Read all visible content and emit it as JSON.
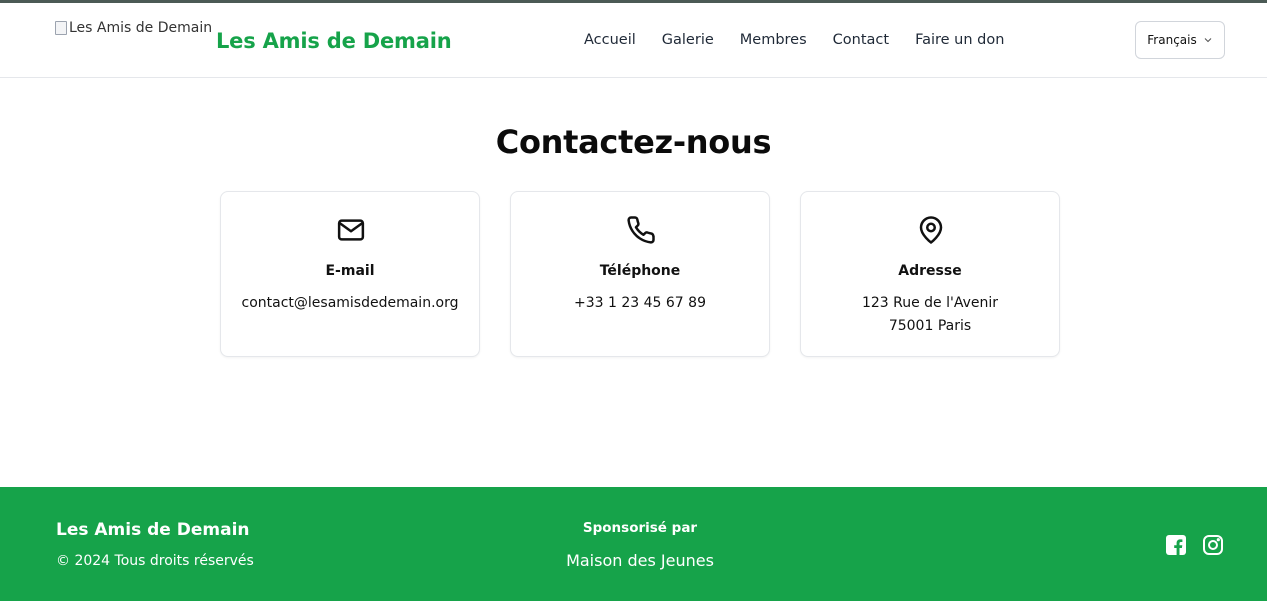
{
  "header": {
    "logo_alt": "Les Amis de Demain",
    "brand": "Les Amis de Demain",
    "nav": [
      "Accueil",
      "Galerie",
      "Membres",
      "Contact",
      "Faire un don"
    ],
    "language": "Français"
  },
  "main": {
    "title": "Contactez-nous",
    "cards": [
      {
        "icon": "mail-icon",
        "label": "E-mail",
        "lines": [
          "contact@lesamisdedemain.org"
        ]
      },
      {
        "icon": "phone-icon",
        "label": "Téléphone",
        "lines": [
          "+33 1 23 45 67 89"
        ]
      },
      {
        "icon": "map-pin-icon",
        "label": "Adresse",
        "lines": [
          "123 Rue de l'Avenir",
          "75001 Paris"
        ]
      }
    ]
  },
  "footer": {
    "brand": "Les Amis de Demain",
    "copyright": "© 2024 Tous droits réservés",
    "sponsor_label": "Sponsorisé par",
    "sponsor_name": "Maison des Jeunes",
    "social": [
      "facebook-icon",
      "instagram-icon"
    ]
  },
  "colors": {
    "brand_green": "#16a34a",
    "text": "#111111",
    "border": "#e5e7eb"
  }
}
